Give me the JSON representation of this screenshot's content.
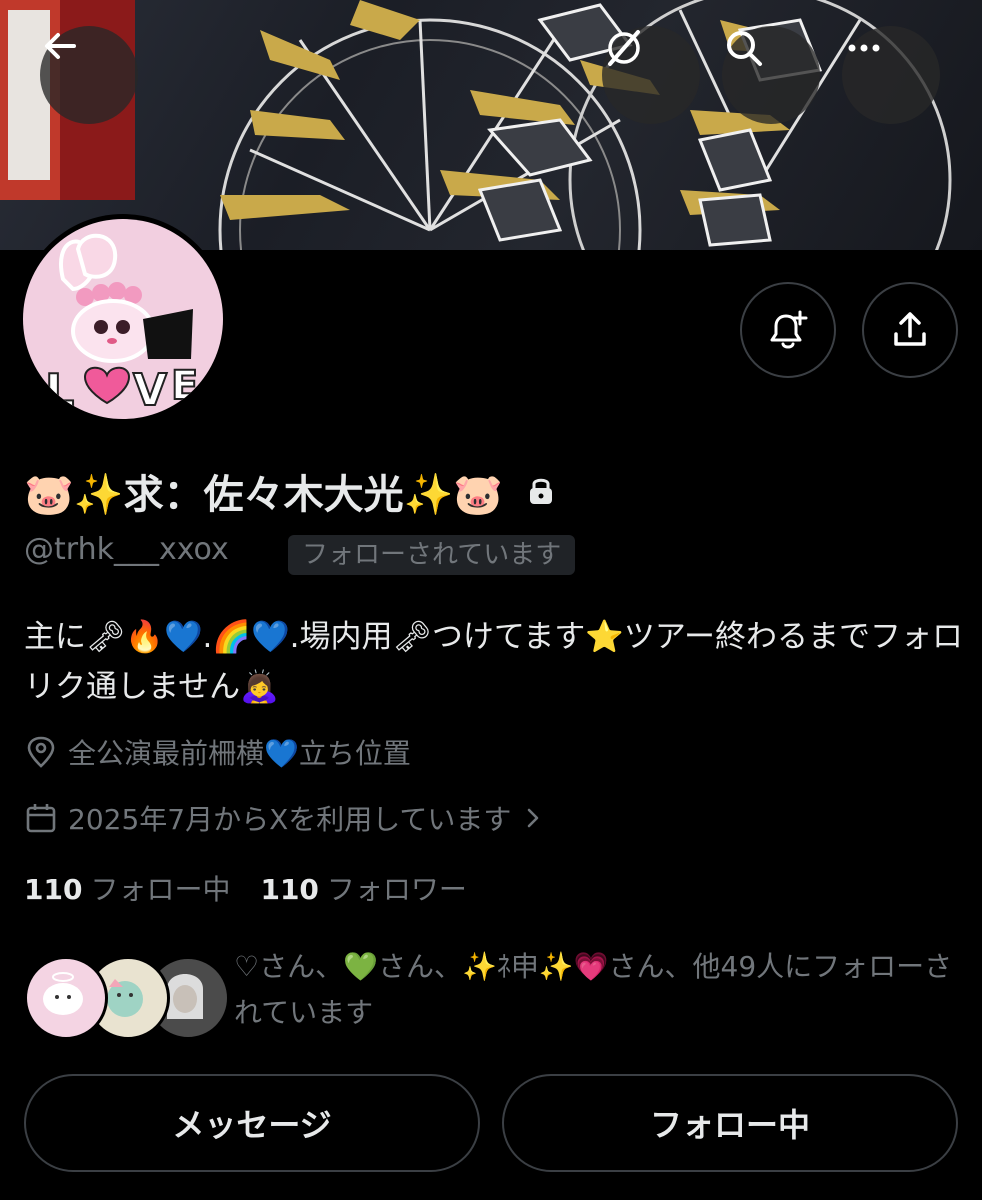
{
  "banner": {
    "description_icon": "ferris-wheel-photo"
  },
  "top_bar": {
    "back_icon": "arrow-left-icon",
    "grok_icon": "grok-icon",
    "search_icon": "search-icon",
    "more_icon": "more-dots-icon"
  },
  "profile": {
    "display_name": "🐷✨求：佐々木大光✨🐷",
    "locked_icon": "lock-icon",
    "handle": "@trhk___xxox",
    "follows_you": "フォローされています",
    "bio": "主に🗝🔥💙.🌈💙.場内用🗝つけてます⭐️ツアー終わるまでフォロリク通しません🙇‍♀️",
    "location": "全公演最前柵横💙立ち位置",
    "joined": "2025年7月からXを利用しています",
    "following_count": "110",
    "following_label": "フォロー中",
    "followers_count": "110",
    "followers_label": "フォロワー",
    "followed_by": "♡さん、💚さん、✨ﾈ申✨💗さん、他49人にフォローされています"
  },
  "actions": {
    "notify_icon": "bell-plus-icon",
    "share_icon": "share-icon",
    "message_label": "メッセージ",
    "following_button_label": "フォロー中"
  }
}
